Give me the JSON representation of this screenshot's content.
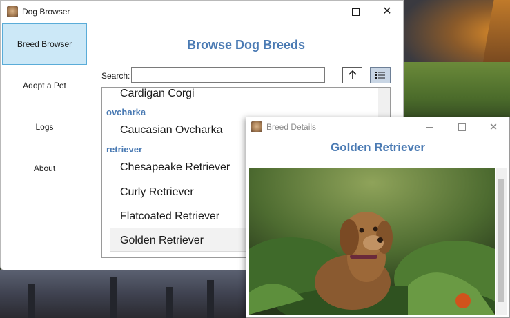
{
  "main_window": {
    "title": "Dog Browser",
    "heading": "Browse Dog Breeds",
    "search": {
      "label": "Search:",
      "value": "",
      "placeholder": ""
    }
  },
  "nav": {
    "items": [
      {
        "label": "Breed Browser",
        "active": true
      },
      {
        "label": "Adopt a Pet",
        "active": false
      },
      {
        "label": "Logs",
        "active": false
      },
      {
        "label": "About",
        "active": false
      }
    ]
  },
  "toolbar": {
    "sort_icon": "arrow-up-icon",
    "view_icon": "list-view-icon"
  },
  "breed_list": {
    "rows": [
      {
        "kind": "item",
        "text": "Cardigan Corgi"
      },
      {
        "kind": "group",
        "text": "ovcharka"
      },
      {
        "kind": "item",
        "text": "Caucasian Ovcharka"
      },
      {
        "kind": "group",
        "text": "retriever"
      },
      {
        "kind": "item",
        "text": "Chesapeake Retriever"
      },
      {
        "kind": "item",
        "text": "Curly Retriever"
      },
      {
        "kind": "item",
        "text": "Flatcoated Retriever"
      },
      {
        "kind": "item",
        "text": "Golden Retriever",
        "selected": true
      }
    ]
  },
  "details_window": {
    "title": "Breed Details",
    "heading": "Golden Retriever"
  },
  "colors": {
    "accent": "#4a7ab3",
    "nav_active_bg": "#cce8f7",
    "nav_active_border": "#5aacd8"
  }
}
